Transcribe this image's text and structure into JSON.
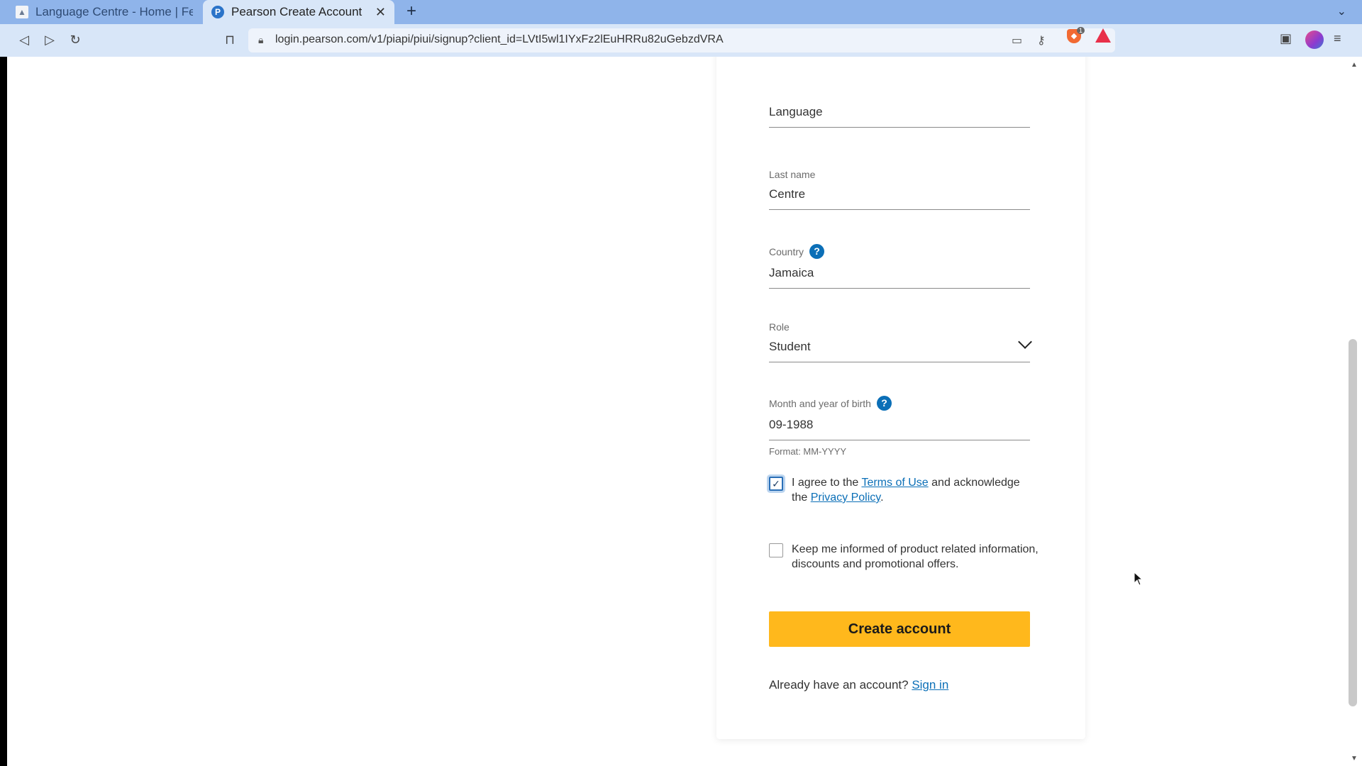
{
  "browser": {
    "tabs": [
      {
        "title": "Language Centre - Home | Fe",
        "active": false,
        "icon": "site-favicon-icon"
      },
      {
        "title": "Pearson Create Account",
        "active": true,
        "icon": "pearson-favicon-icon"
      }
    ],
    "url": "login.pearson.com/v1/piapi/piui/signup?client_id=LVtI5wl1IYxFz2lEuHRRu82uGebzdVRA",
    "brave_shield_count": "1"
  },
  "form": {
    "first_name_value": "Language",
    "last_name_label": "Last name",
    "last_name_value": "Centre",
    "country_label": "Country",
    "country_value": "Jamaica",
    "role_label": "Role",
    "role_value": "Student",
    "dob_label": "Month and year of birth",
    "dob_value": "09-1988",
    "dob_hint": "Format: MM-YYYY",
    "help_glyph": "?",
    "terms": {
      "checked": true,
      "prefix": "I agree to the ",
      "terms_link": "Terms of Use",
      "middle": " and acknowledge the ",
      "privacy_link": "Privacy Policy",
      "suffix": "."
    },
    "marketing": {
      "checked": false,
      "text": "Keep me informed of product related information, discounts and promotional offers."
    },
    "create_button": "Create account",
    "signin_prompt": "Already have an account? ",
    "signin_link": "Sign in"
  },
  "colors": {
    "accent_button": "#ffb81c",
    "link": "#0b6fb7",
    "tabbar": "#8fb4ea"
  }
}
